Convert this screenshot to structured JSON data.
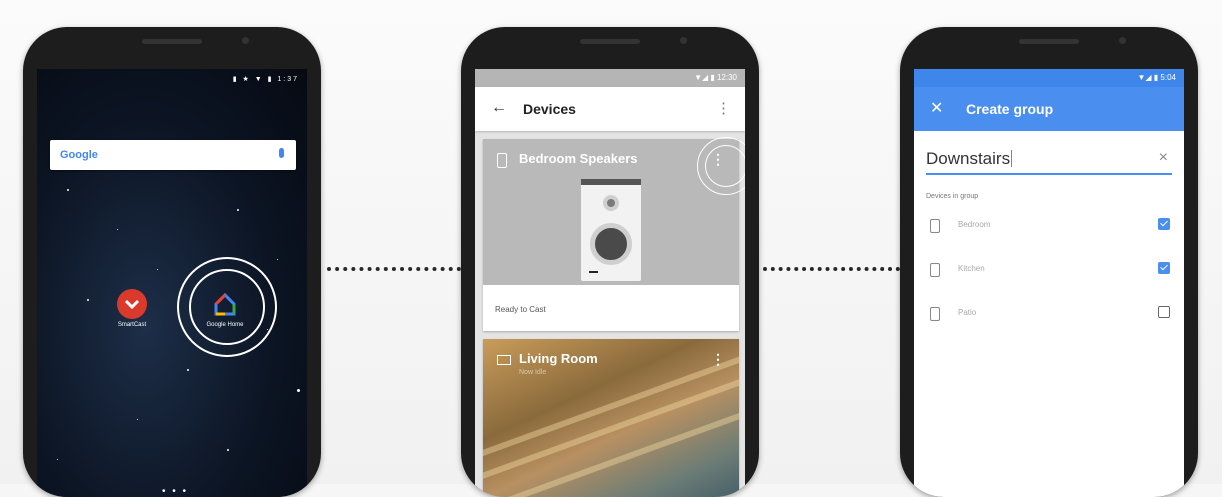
{
  "phone1": {
    "status_text": "▮ ★ ▼ ▮ 1:37",
    "search_logo": "Google",
    "apps": [
      {
        "label": "SmartCast"
      },
      {
        "label": "Google Home"
      }
    ],
    "page_dots": "• • •"
  },
  "phone2": {
    "status_text": "▼◢ ▮ 12:30",
    "title": "Devices",
    "cards": [
      {
        "name": "Bedroom Speakers",
        "status": "Ready to Cast"
      },
      {
        "name": "Living Room",
        "subtitle": "Now Idle"
      }
    ]
  },
  "phone3": {
    "status_text": "▼◢ ▮ 5:04",
    "title": "Create group",
    "group_name": "Downstairs",
    "section_label": "Devices in group",
    "devices": [
      {
        "label": "Bedroom",
        "checked": true
      },
      {
        "label": "Kitchen",
        "checked": true
      },
      {
        "label": "Patio",
        "checked": false
      }
    ]
  },
  "colors": {
    "accent": "#4a8ef0",
    "status_blue": "#3f86ea",
    "card_gray": "#b9b9b9",
    "smartcast_red": "#d93a2b"
  },
  "icons": {
    "back": "arrow-left-icon",
    "close": "close-icon",
    "more": "more-vert-icon",
    "speaker": "speaker-icon",
    "tv": "tv-icon",
    "mic": "mic-icon"
  }
}
